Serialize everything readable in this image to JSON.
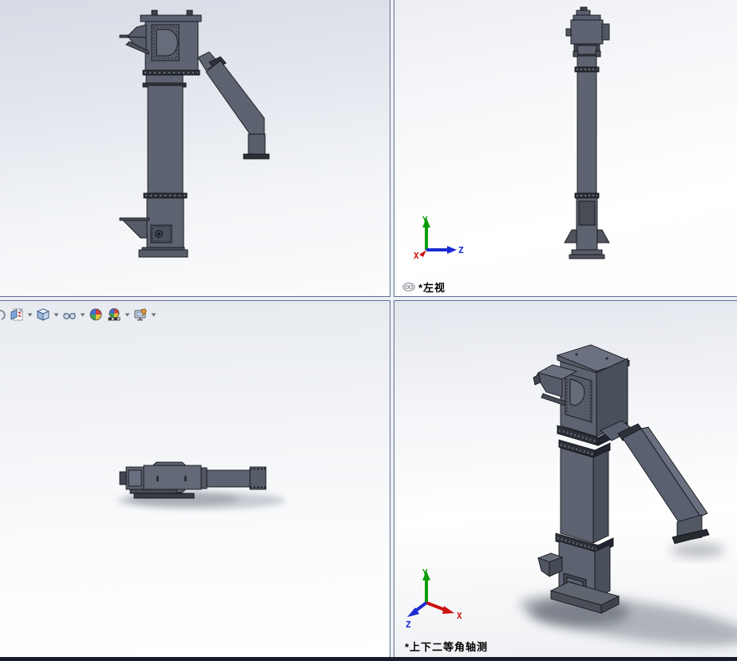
{
  "viewports": {
    "front": {
      "position": "top-left"
    },
    "left": {
      "position": "top-right",
      "label": "*左视",
      "axes": {
        "x": "X",
        "y": "Y",
        "z": "Z"
      }
    },
    "top": {
      "position": "bottom-left"
    },
    "isometric": {
      "position": "bottom-right",
      "label": "*上下二等角轴测",
      "axes": {
        "x": "X",
        "y": "Y",
        "z": "Z"
      }
    }
  },
  "toolbar": {
    "items": [
      {
        "name": "clipped-icon",
        "dropdown": false
      },
      {
        "name": "section-view",
        "dropdown": true
      },
      {
        "name": "view-orientation",
        "dropdown": true
      },
      {
        "name": "display-style",
        "dropdown": true
      },
      {
        "name": "edit-appearance",
        "dropdown": false
      },
      {
        "name": "apply-scene",
        "dropdown": true
      },
      {
        "name": "view-settings",
        "dropdown": true
      }
    ]
  },
  "model": {
    "subject": "bucket elevator assembly",
    "body_color": "#5d6370",
    "edge_color": "#15161a",
    "flange_color": "#2c2f36"
  },
  "axis_colors": {
    "x": "#cc1111",
    "y": "#0a9c0a",
    "z": "#1c2bd0"
  }
}
